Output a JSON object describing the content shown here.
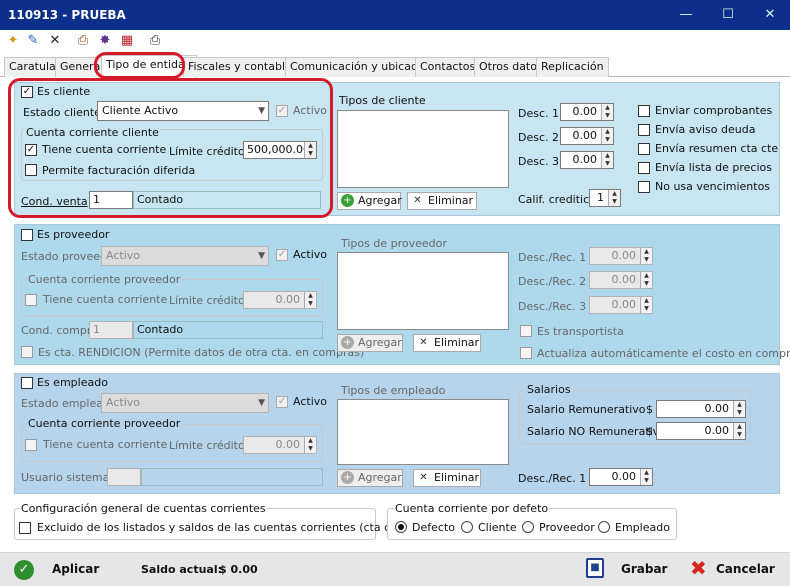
{
  "window": {
    "title": "110913 - PRUEBA",
    "minimize_icon": "minimize-icon",
    "maximize_icon": "maximize-icon",
    "close_icon": "close-icon"
  },
  "toolbar": {
    "icons": [
      "new-document-icon",
      "edit-icon",
      "delete-icon",
      "print-icon",
      "settings-icon",
      "report-icon",
      "export-icon"
    ]
  },
  "tabs": [
    {
      "label": "Caratula"
    },
    {
      "label": "General"
    },
    {
      "label": "Tipo de entidad",
      "active": true
    },
    {
      "label": "Fiscales y contables"
    },
    {
      "label": "Comunicación y ubicación"
    },
    {
      "label": "Contactos"
    },
    {
      "label": "Otros datos"
    },
    {
      "label": "Replicación"
    }
  ],
  "cliente": {
    "checkbox_label": "Es cliente",
    "checked": true,
    "estado_label": "Estado cliente",
    "estado_value": "Cliente Activo",
    "activo_label": "Activo",
    "cc_frame_title": "Cuenta corriente cliente",
    "tiene_cc_label": "Tiene cuenta corriente",
    "tiene_cc_checked": true,
    "limite_label": "Límite crédito $",
    "limite_value": "500,000.00",
    "permite_label": "Permite facturación diferida",
    "cond_label": "Cond. venta",
    "cond_code": "1",
    "cond_desc": "Contado",
    "tipos_title": "Tipos de cliente",
    "agregar_label": "Agregar",
    "eliminar_label": "Eliminar",
    "desc1_label": "Desc. 1",
    "desc1_value": "0.00",
    "desc2_label": "Desc. 2",
    "desc2_value": "0.00",
    "desc3_label": "Desc. 3",
    "desc3_value": "0.00",
    "calif_label": "Calif. crediticia",
    "calif_value": "1",
    "options": [
      "Enviar comprobantes",
      "Envía aviso deuda",
      "Envía resumen cta cte",
      "Envía lista de precios",
      "No usa vencimientos"
    ]
  },
  "proveedor": {
    "checkbox_label": "Es proveedor",
    "estado_label": "Estado proveed.",
    "estado_value": "Activo",
    "activo_label": "Activo",
    "cc_frame_title": "Cuenta corriente proveedor",
    "tiene_cc_label": "Tiene cuenta corriente",
    "limite_label": "Límite crédito $",
    "limite_value": "0.00",
    "cond_label": "Cond. compra",
    "cond_code": "1",
    "cond_desc": "Contado",
    "rendicion_label": "Es cta. RENDICION (Permite datos de otra cta. en compras)",
    "tipos_title": "Tipos de proveedor",
    "agregar_label": "Agregar",
    "eliminar_label": "Eliminar",
    "rec1_label": "Desc./Rec. 1",
    "rec1_value": "0.00",
    "rec2_label": "Desc./Rec. 2",
    "rec2_value": "0.00",
    "rec3_label": "Desc./Rec. 3",
    "rec3_value": "0.00",
    "transportista_label": "Es transportista",
    "actualiza_label": "Actualiza automáticamente el costo en compras"
  },
  "empleado": {
    "checkbox_label": "Es empleado",
    "estado_label": "Estado empleado",
    "estado_value": "Activo",
    "activo_label": "Activo",
    "cc_frame_title": "Cuenta corriente proveedor",
    "tiene_cc_label": "Tiene cuenta corriente",
    "limite_label": "Límite crédito $",
    "limite_value": "0.00",
    "usuario_label": "Usuario sistema",
    "tipos_title": "Tipos de empleado",
    "agregar_label": "Agregar",
    "eliminar_label": "Eliminar",
    "salarios_title": "Salarios",
    "sal_rem_label": "Salario Remunerativo",
    "sal_rem_currency": "$",
    "sal_rem_value": "0.00",
    "sal_norem_label": "Salario NO Remunerativo",
    "sal_norem_currency": "$",
    "sal_norem_value": "0.00",
    "rec1_label": "Desc./Rec. 1",
    "rec1_value": "0.00"
  },
  "config": {
    "frame_title": "Configuración general de cuentas corrientes",
    "excluido_label": "Excluido de los listados y saldos de las cuentas corrientes (cta cte oculta)",
    "default_frame_title": "Cuenta corriente por defeto",
    "radios": [
      "Defecto",
      "Cliente",
      "Proveedor",
      "Empleado"
    ],
    "selected": "Defecto"
  },
  "footer": {
    "aplicar_label": "Aplicar",
    "saldo_label": "Saldo actual:",
    "saldo_value": "$ 0.00",
    "grabar_label": "Grabar",
    "cancelar_label": "Cancelar"
  },
  "colors": {
    "titlebar": "#0b2f8a",
    "cliente_bg": "#c8e6f2",
    "proveedor_bg": "#aed9ec",
    "empleado_bg": "#b6d4ec",
    "highlight": "#d51a2a"
  }
}
